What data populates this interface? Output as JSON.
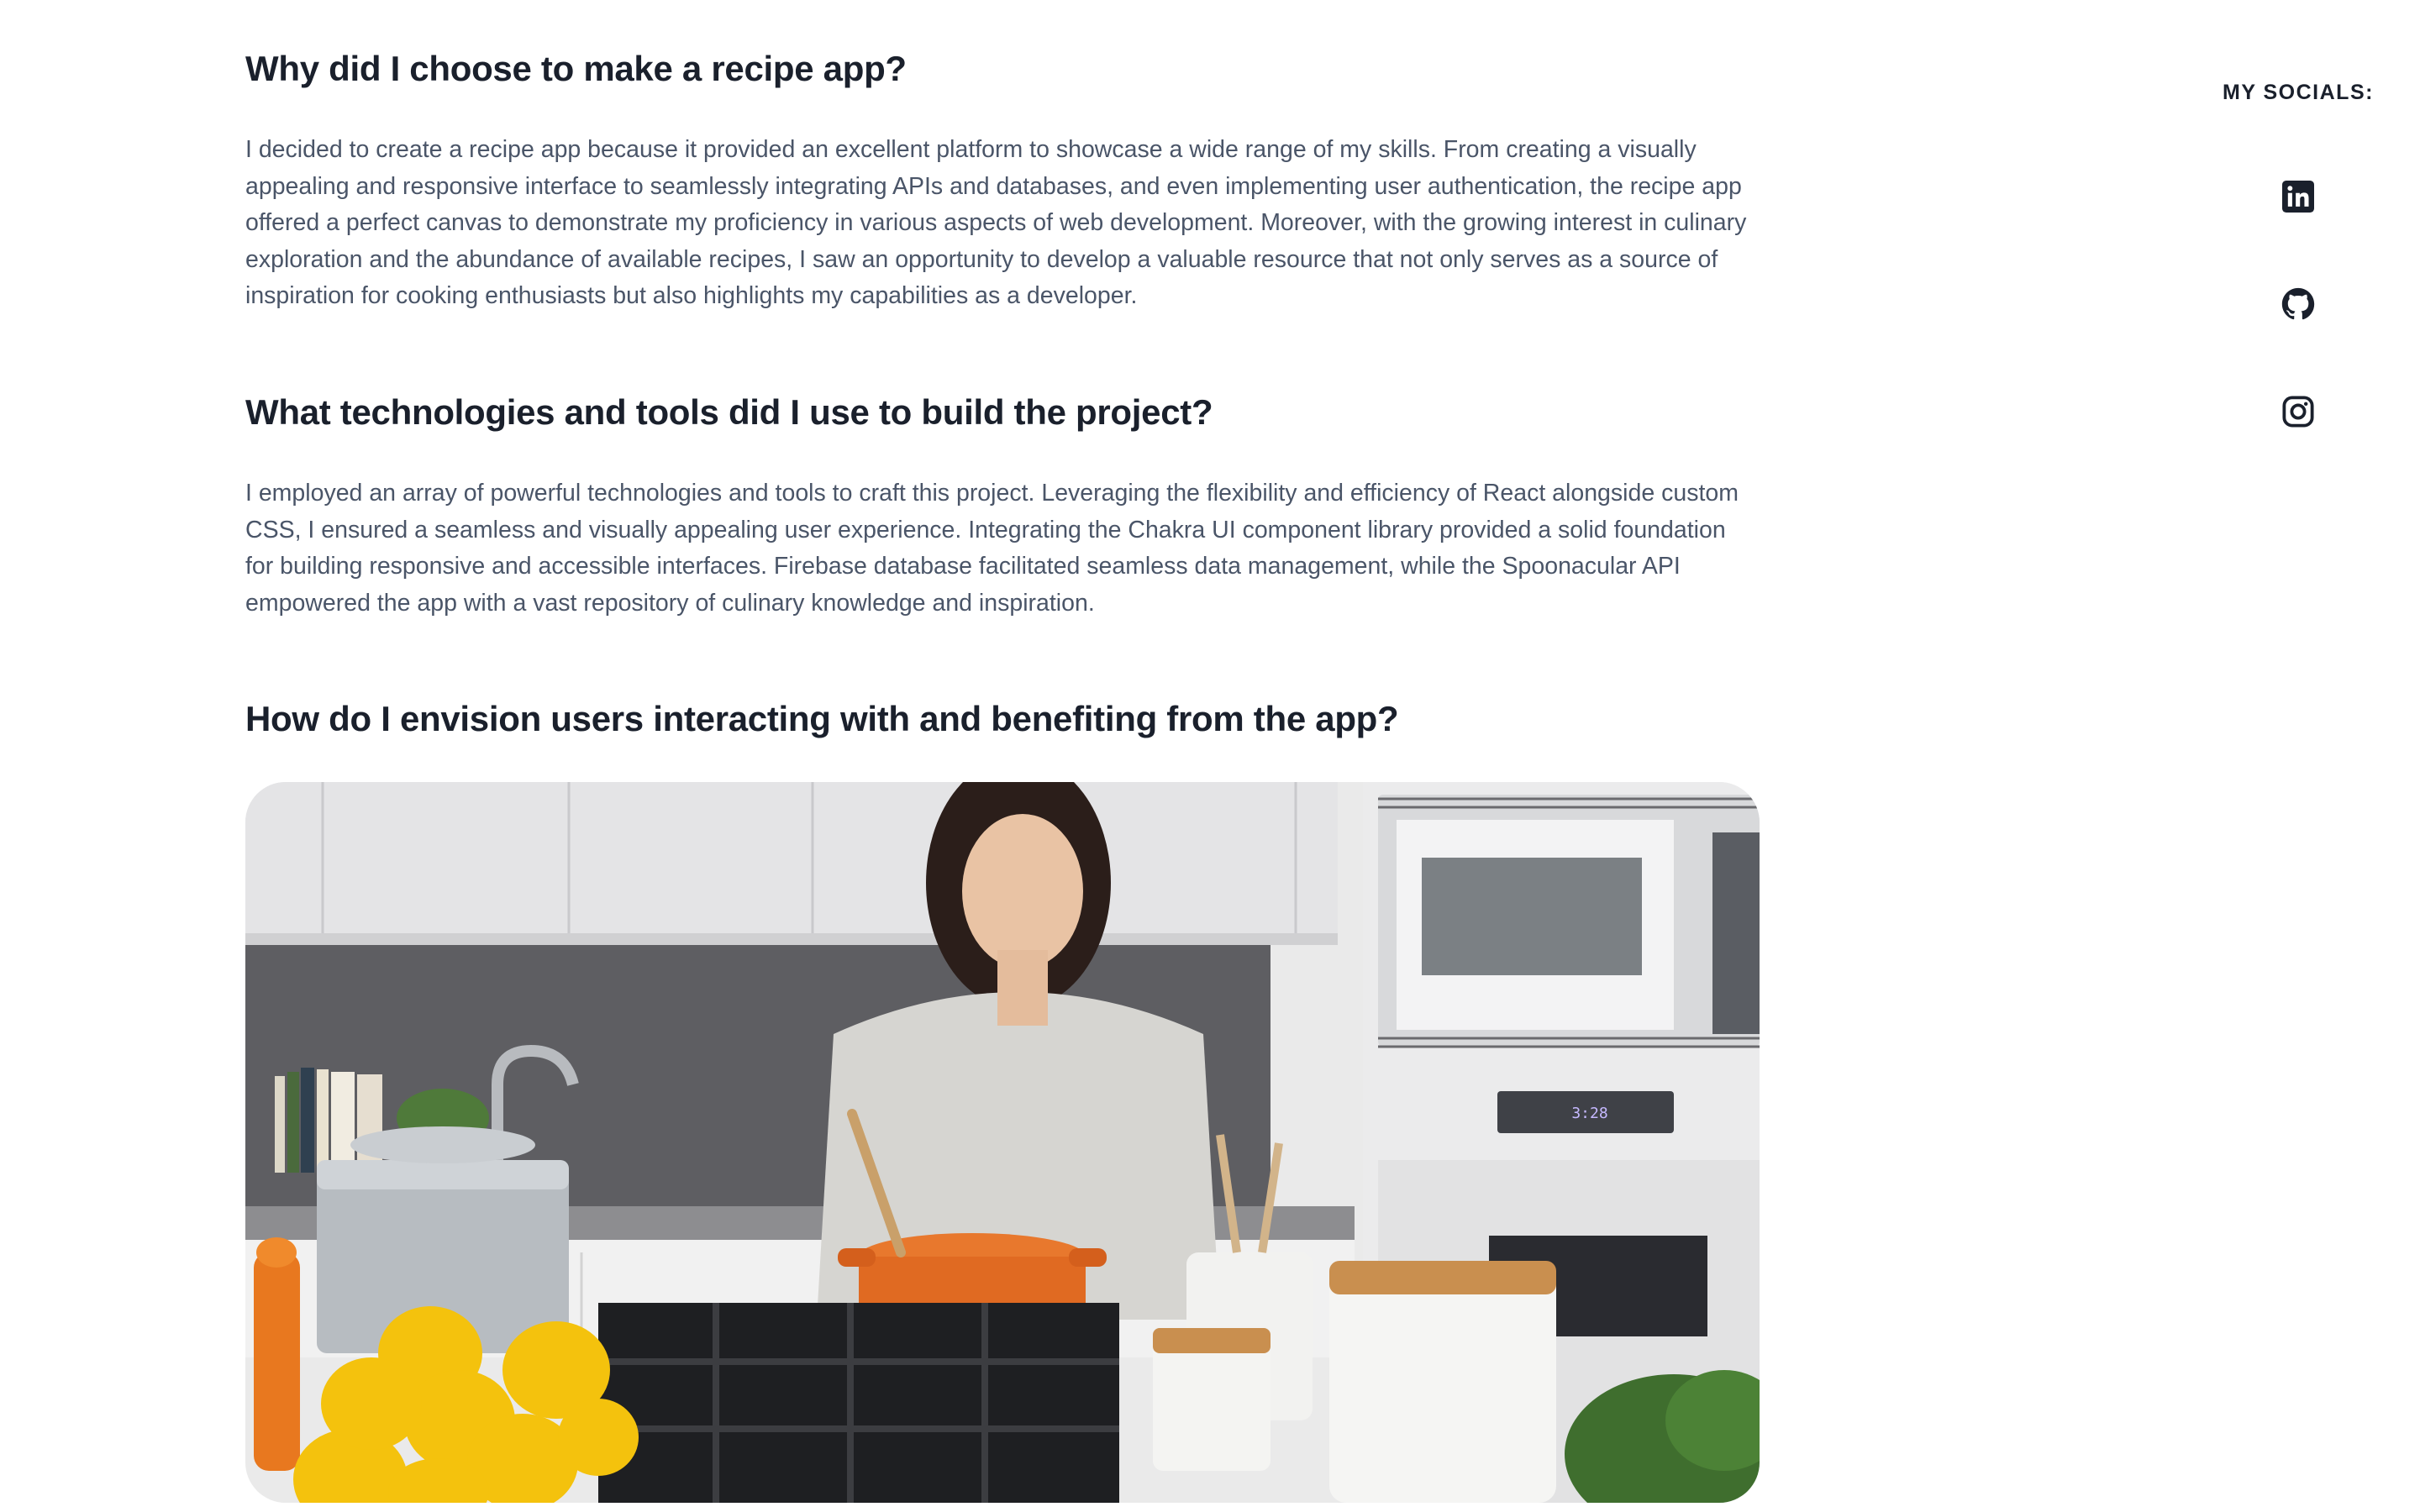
{
  "sections": [
    {
      "heading": "Why did I choose to make a recipe app?",
      "body": "I decided to create a recipe app because it provided an excellent platform to showcase a wide range of my skills. From creating a visually appealing and responsive interface to seamlessly integrating APIs and databases, and even implementing user authentication, the recipe app offered a perfect canvas to demonstrate my proficiency in various aspects of web development. Moreover, with the growing interest in culinary exploration and the abundance of available recipes, I saw an opportunity to develop a valuable resource that not only serves as a source of inspiration for cooking enthusiasts but also highlights my capabilities as a developer."
    },
    {
      "heading": "What technologies and tools did I use to build the project?",
      "body": "I employed an array of powerful technologies and tools to craft this project. Leveraging the flexibility and efficiency of React alongside custom CSS, I ensured a seamless and visually appealing user experience. Integrating the Chakra UI component library provided a solid foundation for building responsive and accessible interfaces. Firebase database facilitated seamless data management, while the Spoonacular API empowered the app with a vast repository of culinary knowledge and inspiration."
    },
    {
      "heading": "How do I envision users interacting with and benefiting from the app?"
    }
  ],
  "hero_image": {
    "icon": "kitchen-cooking-photo"
  },
  "socials": {
    "label": "MY SOCIALS:",
    "links": [
      {
        "icon": "linkedin-icon"
      },
      {
        "icon": "github-icon"
      },
      {
        "icon": "instagram-icon"
      }
    ]
  },
  "colors": {
    "heading": "#1a202c",
    "body_text": "#4a5568",
    "icon": "#1a202c",
    "background": "#ffffff"
  }
}
